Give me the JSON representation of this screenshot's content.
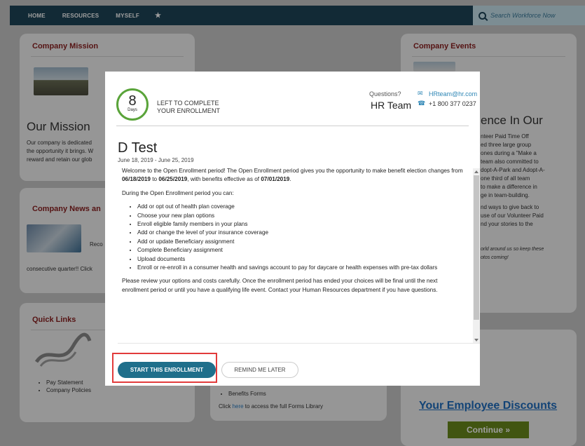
{
  "nav": {
    "items": [
      "HOME",
      "RESOURCES",
      "MYSELF"
    ],
    "star": "★",
    "search_placeholder": "Search Workforce Now"
  },
  "background": {
    "mission": {
      "title": "Company Mission",
      "heading": "Our Mission",
      "lines": [
        "Our company is dedicated",
        "the opportunity it brings. W",
        "reward and retain our glob"
      ]
    },
    "news": {
      "title": "Company News an",
      "snippet_right": "Reco",
      "snippet": "consecutive quarter!! Click"
    },
    "quick_links": {
      "title": "Quick Links",
      "items": [
        "Pay Statement",
        "Company Policies"
      ]
    },
    "forms": {
      "item": "Benefits Forms",
      "footer_pre": "Click ",
      "footer_link": "here",
      "footer_post": " to access the full Forms Library"
    },
    "events": {
      "title": "Company Events",
      "heading": "ence In Our",
      "lines": [
        "nteer Paid Time Off",
        "ed three large group",
        "ones during a \"Make a",
        "team also committed to",
        "dopt-A-Park and Adopt-A-",
        "one third of all team",
        "to make a difference in",
        "ge in team-building.",
        "nd ways to give back to",
        "use of our Volunteer Paid",
        "nd your stories to the"
      ],
      "italic_lines": [
        "orld around us so keep these",
        "otos coming!"
      ]
    },
    "discounts_title": "Your Employee Discounts",
    "continue_label": "Continue »"
  },
  "modal": {
    "days_number": "8",
    "days_label": "Days",
    "left_text_1": "LEFT TO COMPLETE",
    "left_text_2": "YOUR ENROLLMENT",
    "questions_label": "Questions?",
    "team_name": "HR Team",
    "email": "HRteam@hr.com",
    "phone": "+1 800 377 0237",
    "enrollment_name": "D Test",
    "enrollment_dates": "June 18, 2019 - June 25, 2019",
    "intro_a": "Welcome to the Open Enrollment period! The Open Enrollment period gives you the opportunity to make benefit election changes from ",
    "intro_date1": "06/18/2019",
    "intro_b": " to ",
    "intro_date2": "06/25/2019",
    "intro_c": ", with benefits effective as of ",
    "intro_date3": "07/01/2019",
    "intro_d": ".",
    "during_text": "During the Open Enrollment period you can:",
    "actions": [
      "Add or opt out of health plan coverage",
      "Choose your new plan options",
      "Enroll eligible family members in your plans",
      "Add or change the level of your insurance coverage",
      "Add or update Beneficiary assignment",
      "Complete Beneficiary assignment",
      "Upload documents",
      "Enroll or re-enroll in a consumer health and savings account to pay for daycare or health expenses with pre-tax dollars"
    ],
    "closing_text": "Please review your options and costs carefully. Once the enrollment period has ended your choices will be final until the next enrollment period or until you have a qualifying life event. Contact your Human Resources department if you have questions.",
    "start_button": "START THIS ENROLLMENT",
    "remind_button": "REMIND ME LATER"
  },
  "colors": {
    "nav_bg": "#1d4458",
    "accent_green": "#5aa43a",
    "button_teal": "#1f6f8b",
    "highlight_red": "#e23b3b",
    "card_title": "#8a1f1f"
  }
}
